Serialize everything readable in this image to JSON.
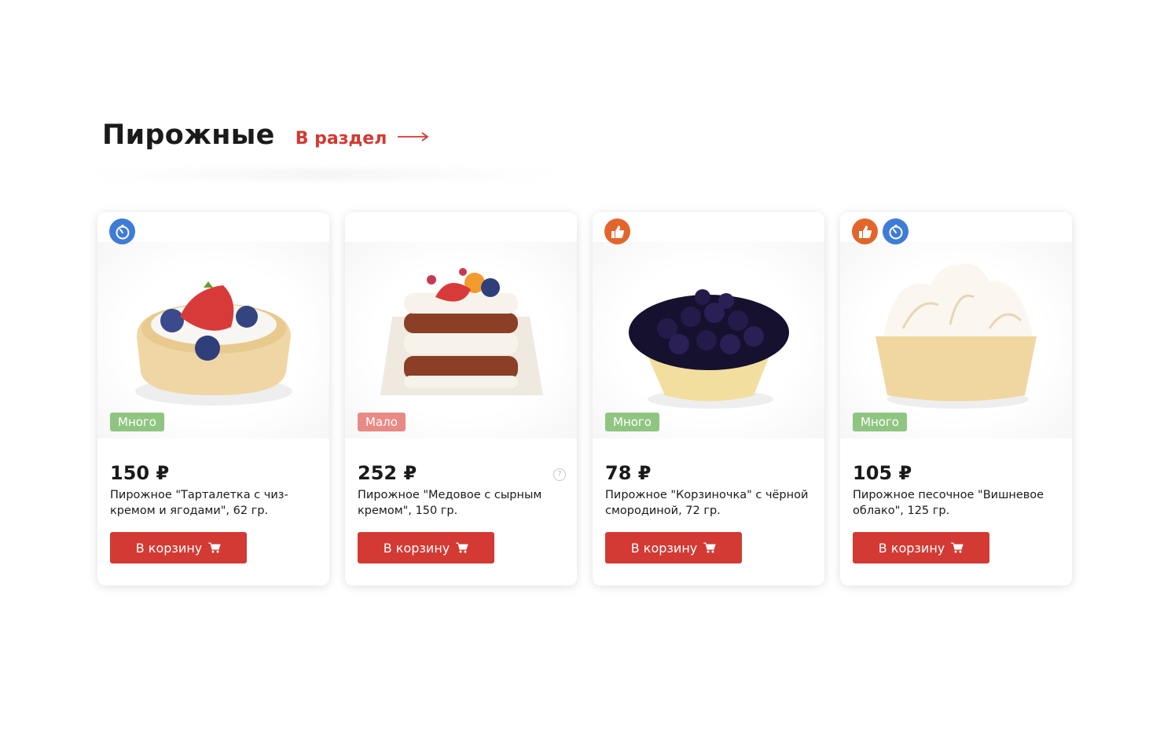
{
  "section": {
    "title": "Пирожные",
    "link_label": "В раздел"
  },
  "colors": {
    "accent": "#d23a33",
    "stock_many": "#8fc581",
    "stock_few": "#e88a86",
    "badge_blue": "#3f7cd8",
    "badge_orange": "#e2662b"
  },
  "products": [
    {
      "badges": [
        "stopwatch-icon"
      ],
      "stock": "Много",
      "price": "150 ₽",
      "name": "Пирожное \"Тарталетка с чиз-кремом и ягодами\", 62 гр.",
      "button": "В корзину"
    },
    {
      "badges": [],
      "stock": "Мало",
      "price": "252 ₽",
      "help": "?",
      "name": "Пирожное \"Медовое с сырным кремом\", 150 гр.",
      "button": "В корзину"
    },
    {
      "badges": [
        "thumbs-up-icon"
      ],
      "stock": "Много",
      "price": "78 ₽",
      "name": "Пирожное \"Корзиночка\" с чёрной смородиной, 72 гр.",
      "button": "В корзину"
    },
    {
      "badges": [
        "thumbs-up-icon",
        "stopwatch-icon"
      ],
      "stock": "Много",
      "price": "105 ₽",
      "name": "Пирожное песочное \"Вишневое облако\", 125 гр.",
      "button": "В корзину"
    }
  ]
}
